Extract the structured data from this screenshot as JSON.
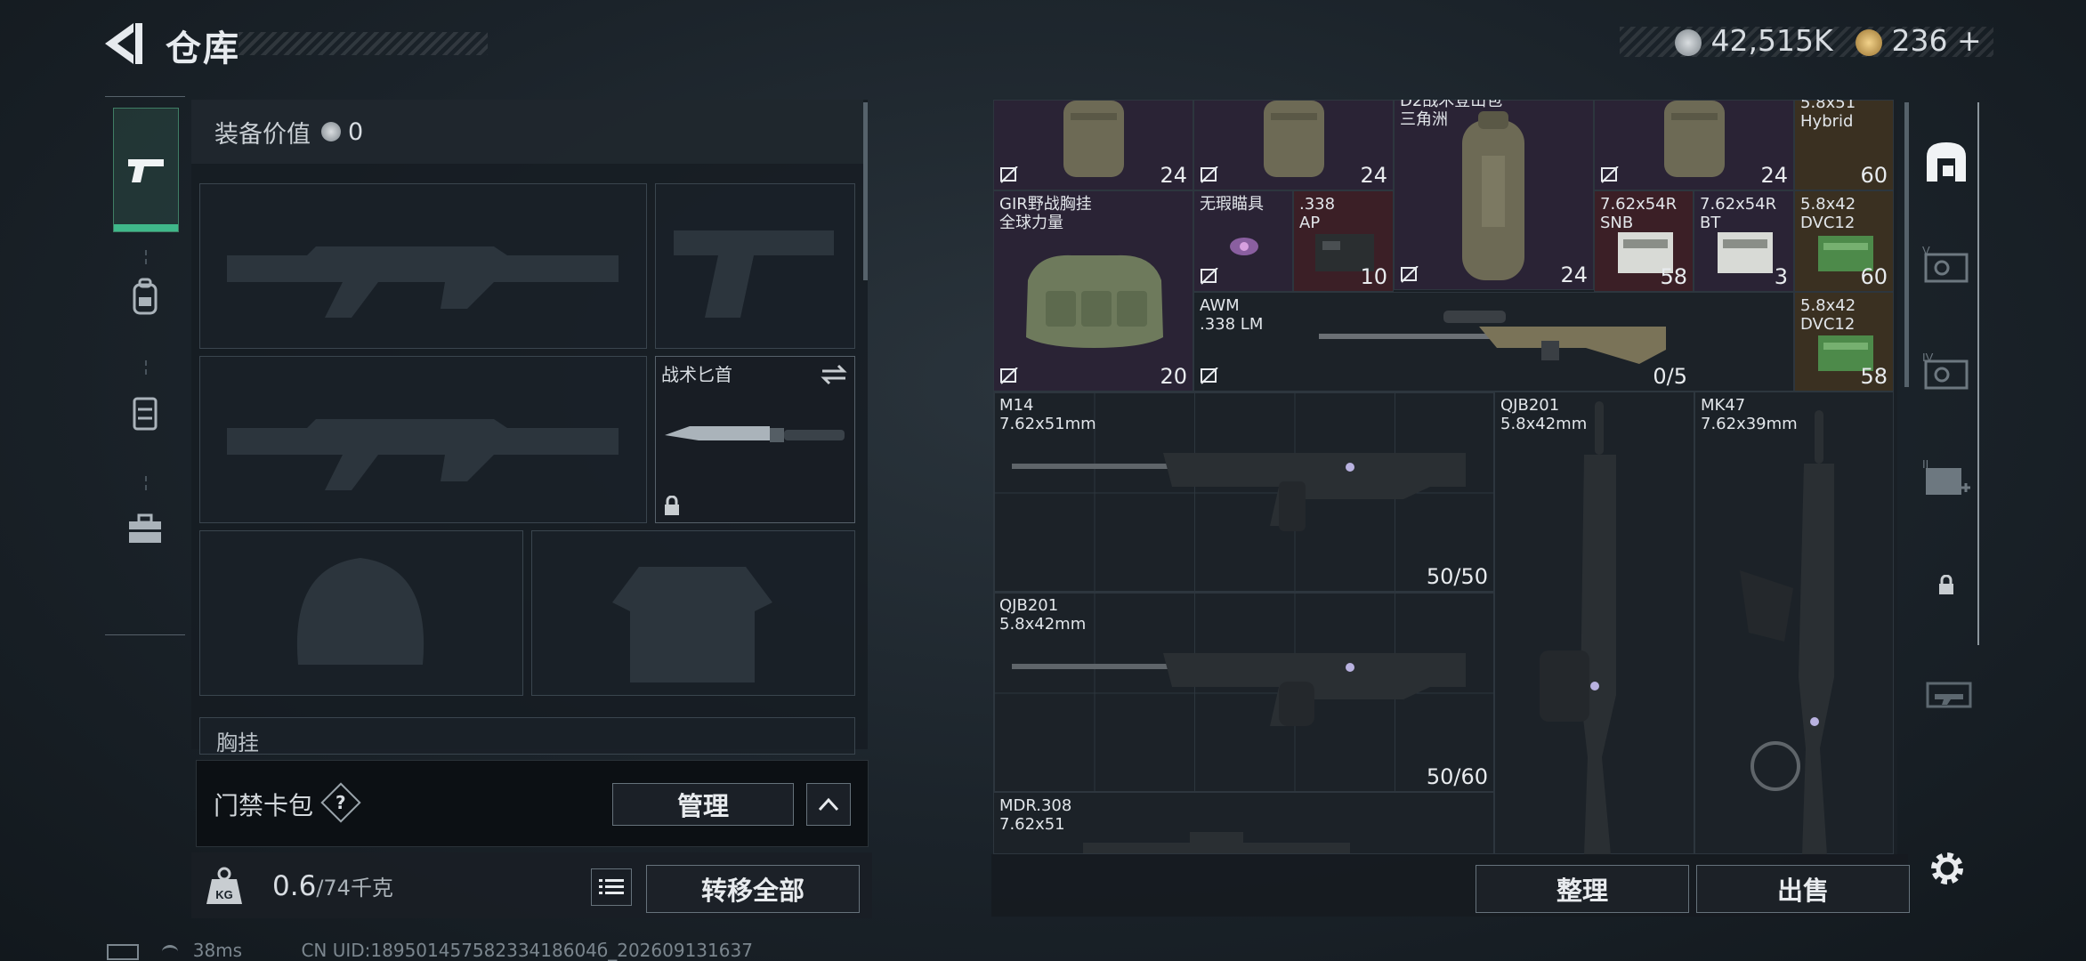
{
  "header": {
    "title": "仓库"
  },
  "currency": {
    "silver": "42,515K",
    "gold": "236",
    "plus": "+"
  },
  "equipment": {
    "value_label": "装备价值",
    "value": "0",
    "melee_name": "战术匕首",
    "chest_label": "胸挂"
  },
  "card_bag": {
    "label": "门禁卡包",
    "help": "?",
    "manage": "管理"
  },
  "weight": {
    "current": "0.6",
    "max": "/74千克",
    "transfer_all": "转移全部"
  },
  "storage": {
    "items": [
      {
        "name": "",
        "count": "24"
      },
      {
        "name": "",
        "count": "24"
      },
      {
        "name": "D2战术登山包\n三角洲",
        "count": "24"
      },
      {
        "name": "",
        "count": "24"
      },
      {
        "name": "5.8x51\nHybrid",
        "count": "60"
      },
      {
        "name": "GIR野战胸挂\n全球力量",
        "count": "20"
      },
      {
        "name": "无瑕瞄具",
        "count": ""
      },
      {
        "name": ".338\nAP",
        "count": "10"
      },
      {
        "name": "7.62x54R\nSNB",
        "count": "58"
      },
      {
        "name": "7.62x54R\nBT",
        "count": "3"
      },
      {
        "name": "5.8x42\nDVC12",
        "count": "60"
      },
      {
        "name": "AWM\n.338 LM",
        "count": "0/5"
      },
      {
        "name": "5.8x42\nDVC12",
        "count": "58"
      },
      {
        "name": "M14\n7.62x51mm",
        "count": "50/50"
      },
      {
        "name": "QJB201\n5.8x42mm",
        "count": ""
      },
      {
        "name": "MK47\n7.62x39mm",
        "count": ""
      },
      {
        "name": "QJB201\n5.8x42mm",
        "count": "50/60"
      },
      {
        "name": "MDR.308\n7.62x51",
        "count": ""
      }
    ],
    "sort": "整理",
    "sell": "出售"
  },
  "status_bar": {
    "ping": "38ms",
    "uid": "CN UID:18950145758233418604б_202609131637"
  },
  "icons": {
    "back": "back-arrow-icon",
    "silver": "silver-coin-icon",
    "gold": "gold-coin-icon",
    "rail": [
      "pistol-icon",
      "backpack-icon",
      "chest-rig-icon",
      "toolbox-icon"
    ],
    "rtabs": [
      "storage-home-icon",
      "locker-v-icon",
      "locker-iv-icon",
      "locker-ii-icon",
      "locked-tab-icon",
      "gun-case-icon"
    ],
    "settings": "gear-icon"
  },
  "colors": {
    "accent": "#3fb88a",
    "rare_purple": "#2a2335",
    "epic_red": "#3b1f26",
    "legend_gold": "#3a3021"
  }
}
